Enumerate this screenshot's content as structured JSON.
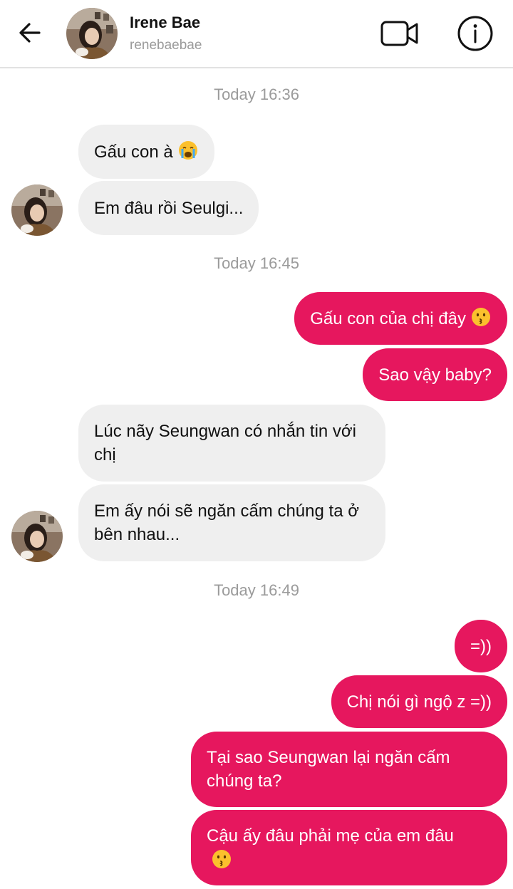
{
  "header": {
    "name": "Irene Bae",
    "handle": "renebaebae"
  },
  "timestamps": [
    "Today 16:36",
    "Today 16:45",
    "Today 16:49"
  ],
  "messages": [
    {
      "side": "in",
      "text": "Gấu con à",
      "emoji": "crying-face"
    },
    {
      "side": "in",
      "text": "Em đâu rồi Seulgi..."
    },
    {
      "side": "out",
      "text": "Gấu con của chị đây",
      "emoji": "kissing-face"
    },
    {
      "side": "out",
      "text": "Sao vậy baby?"
    },
    {
      "side": "in",
      "text": "Lúc nãy Seungwan có nhắn tin với chị"
    },
    {
      "side": "in",
      "text": "Em ấy nói sẽ ngăn cấm chúng ta ở bên nhau..."
    },
    {
      "side": "out",
      "text": "=))"
    },
    {
      "side": "out",
      "text": "Chị nói gì ngộ z =))"
    },
    {
      "side": "out",
      "text": "Tại sao Seungwan lại ngăn cấm chúng ta?"
    },
    {
      "side": "out",
      "text": "Cậu ấy đâu phải mẹ của em đâu",
      "emoji": "kissing-face"
    }
  ],
  "colors": {
    "outgoing_bubble": "#e6175e",
    "incoming_bubble": "#efefef",
    "timestamp": "#9b9b9b"
  }
}
